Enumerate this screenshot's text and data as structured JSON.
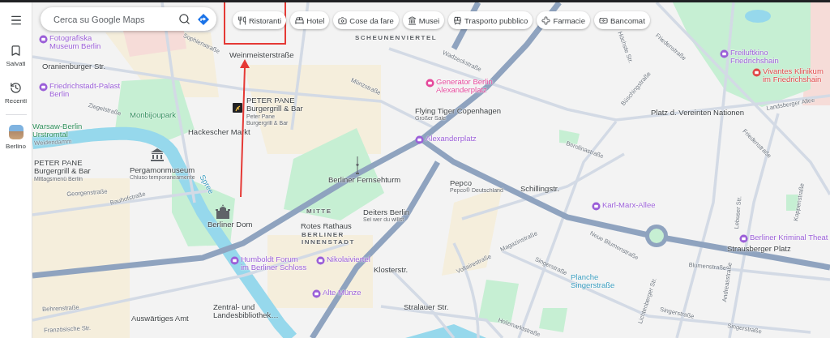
{
  "sidebar": {
    "items": [
      {
        "label": "Salvati"
      },
      {
        "label": "Recenti"
      },
      {
        "label": "Berlino"
      }
    ]
  },
  "search": {
    "placeholder": "Cerca su Google Maps"
  },
  "chips": [
    {
      "label": "Ristoranti"
    },
    {
      "label": "Hotel"
    },
    {
      "label": "Cose da fare"
    },
    {
      "label": "Musei"
    },
    {
      "label": "Trasporto pubblico"
    },
    {
      "label": "Farmacie"
    },
    {
      "label": "Bancomat"
    }
  ],
  "map": {
    "labels": [
      {
        "kind": "poi",
        "text": "Fotografiska\nMuseum Berlin"
      },
      {
        "kind": "place",
        "text": "Oranienburger Str."
      },
      {
        "kind": "poi",
        "text": "Friedrichstadt-Palast\nBerlin"
      },
      {
        "kind": "street",
        "text": "Ziegelstraße"
      },
      {
        "kind": "park",
        "text": "Monbijoupark"
      },
      {
        "kind": "park",
        "text": "Warsaw-Berlin\nUrstromtal"
      },
      {
        "kind": "street",
        "text": "Weidendamm"
      },
      {
        "kind": "place",
        "text": "PETER PANE\nBurgergrill & Bar",
        "note": "Mittagsmenü Berlin"
      },
      {
        "kind": "place",
        "text": "Pergamonmuseum",
        "note": "Chiuso temporaneamente"
      },
      {
        "kind": "street",
        "text": "Georgenstraße"
      },
      {
        "kind": "street",
        "text": "Bauhofstraße"
      },
      {
        "kind": "water",
        "text": "Spree"
      },
      {
        "kind": "place",
        "text": "Berliner Dom"
      },
      {
        "kind": "place",
        "text": "Weinmeisterstraße"
      },
      {
        "kind": "street",
        "text": "Sophienstraße"
      },
      {
        "kind": "place",
        "text": "PETER PANE\nBurgergrill & Bar",
        "note": "Peter Pane\nBurgergrill & Bar"
      },
      {
        "kind": "place",
        "text": "Hackescher Markt"
      },
      {
        "kind": "district",
        "text": "SCHEUNENVIERTEL"
      },
      {
        "kind": "street",
        "text": "Münzstraße"
      },
      {
        "kind": "lodging",
        "text": "Generator Berlin\nAlexanderplatz"
      },
      {
        "kind": "place",
        "text": "Flying Tiger Copenhagen",
        "note": "Großer Sale"
      },
      {
        "kind": "poi",
        "text": "Alexanderplatz"
      },
      {
        "kind": "place",
        "text": "Berliner Fernsehturm"
      },
      {
        "kind": "district",
        "text": "MITTE"
      },
      {
        "kind": "place",
        "text": "Deiters Berlin",
        "note": "Sei wer du willst"
      },
      {
        "kind": "place",
        "text": "Rotes Rathaus"
      },
      {
        "kind": "district",
        "text": "BERLINER\nINNENSTADT"
      },
      {
        "kind": "poi",
        "text": "Humboldt Forum\nim Berliner Schloss"
      },
      {
        "kind": "poi",
        "text": "Nikolaiviertel"
      },
      {
        "kind": "place",
        "text": "Klosterstr."
      },
      {
        "kind": "poi",
        "text": "Alte Münze"
      },
      {
        "kind": "place",
        "text": "Zentral- und\nLandesbibliothek…"
      },
      {
        "kind": "place",
        "text": "Auswärtiges Amt"
      },
      {
        "kind": "street",
        "text": "Behrenstraße"
      },
      {
        "kind": "street",
        "text": "Französische Str."
      },
      {
        "kind": "place",
        "text": "Stralauer Str."
      },
      {
        "kind": "street",
        "text": "Holzmarktstraße"
      },
      {
        "kind": "place",
        "text": "Schillingstr."
      },
      {
        "kind": "poi",
        "text": "Karl-Marx-Allee"
      },
      {
        "kind": "street",
        "text": "Neue Blumenstraße"
      },
      {
        "kind": "street",
        "text": "Singerstraße"
      },
      {
        "kind": "water",
        "text": "Planche\nSingerstraße"
      },
      {
        "kind": "street",
        "text": "Lichtenberger Str."
      },
      {
        "kind": "place",
        "text": "Strausberger Platz"
      },
      {
        "kind": "street",
        "text": "Blumenstraße"
      },
      {
        "kind": "street",
        "text": "Andreasstraße"
      },
      {
        "kind": "street",
        "text": "Lebuser Str."
      },
      {
        "kind": "street",
        "text": "Koppenstraße"
      },
      {
        "kind": "poi",
        "text": "Berliner Kriminal Theat"
      },
      {
        "kind": "street",
        "text": "Singerstraße"
      },
      {
        "kind": "street",
        "text": "Singerstraße"
      },
      {
        "kind": "street",
        "text": "Magazinstraße"
      },
      {
        "kind": "street",
        "text": "Voltairestraße"
      },
      {
        "kind": "place",
        "text": "Platz d. Vereinten Nationen"
      },
      {
        "kind": "street",
        "text": "Landsberger Allee"
      },
      {
        "kind": "street",
        "text": "Friedenstraße"
      },
      {
        "kind": "street",
        "text": "Friedenstraße"
      },
      {
        "kind": "street",
        "text": "Büschingstraße"
      },
      {
        "kind": "street",
        "text": "Höchste Str."
      },
      {
        "kind": "street",
        "text": "Berolinastraße"
      },
      {
        "kind": "street",
        "text": "Wadzeckstraße"
      },
      {
        "kind": "poi",
        "text": "Freiluftkino\nFriedrichshain"
      },
      {
        "kind": "health",
        "text": "Vivantes Klinikum\nim Friedrichshain"
      },
      {
        "kind": "place",
        "text": "Pepco",
        "note": "Pepco® Deutschland"
      }
    ]
  }
}
